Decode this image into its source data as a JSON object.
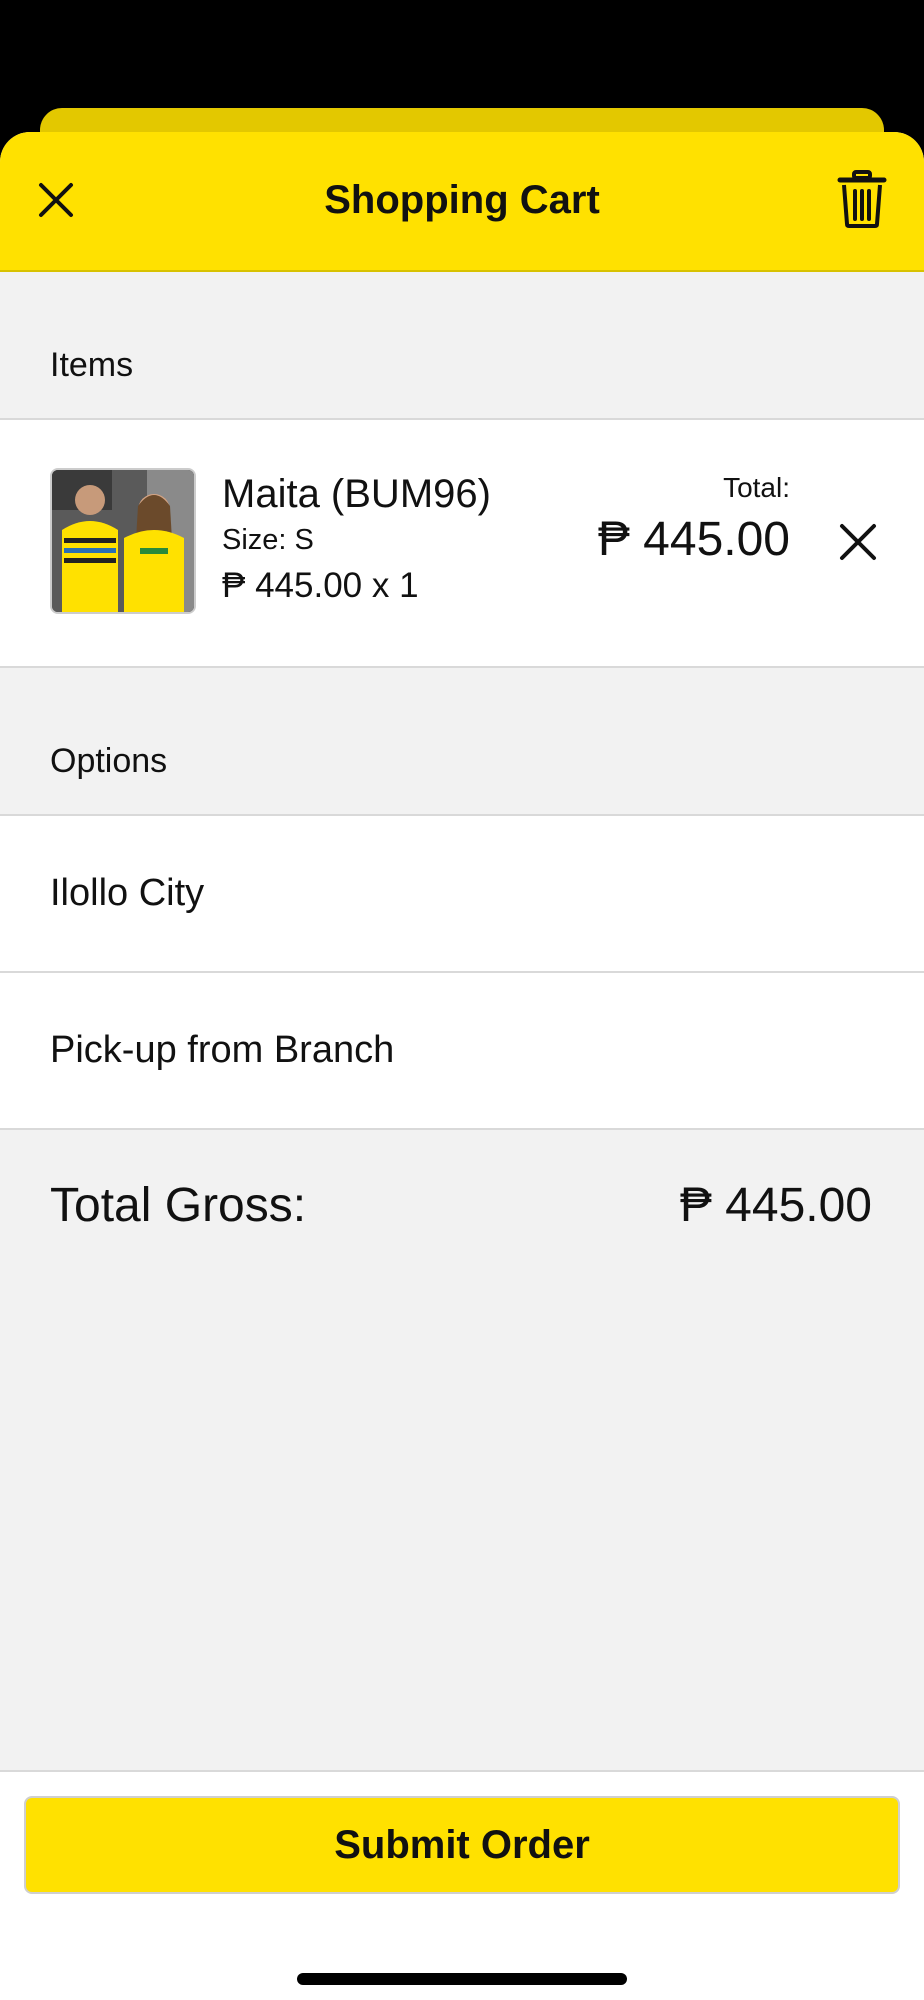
{
  "header": {
    "title": "Shopping Cart",
    "close_icon": "close-icon",
    "trash_icon": "trash-icon",
    "bg_color": "#FFE100"
  },
  "items_section": {
    "label": "Items",
    "items": [
      {
        "name": "Maita (BUM96)",
        "size": "Size: S",
        "price_qty": "₱ 445.00 x 1",
        "total_label": "Total:",
        "total_value": "₱ 445.00",
        "remove_icon": "close-icon"
      }
    ]
  },
  "options_section": {
    "label": "Options",
    "options": [
      {
        "label": "Ilollo City"
      },
      {
        "label": "Pick-up from Branch"
      }
    ]
  },
  "summary": {
    "gross_label": "Total Gross:",
    "gross_value": "₱ 445.00"
  },
  "footer": {
    "submit_label": "Submit Order"
  }
}
